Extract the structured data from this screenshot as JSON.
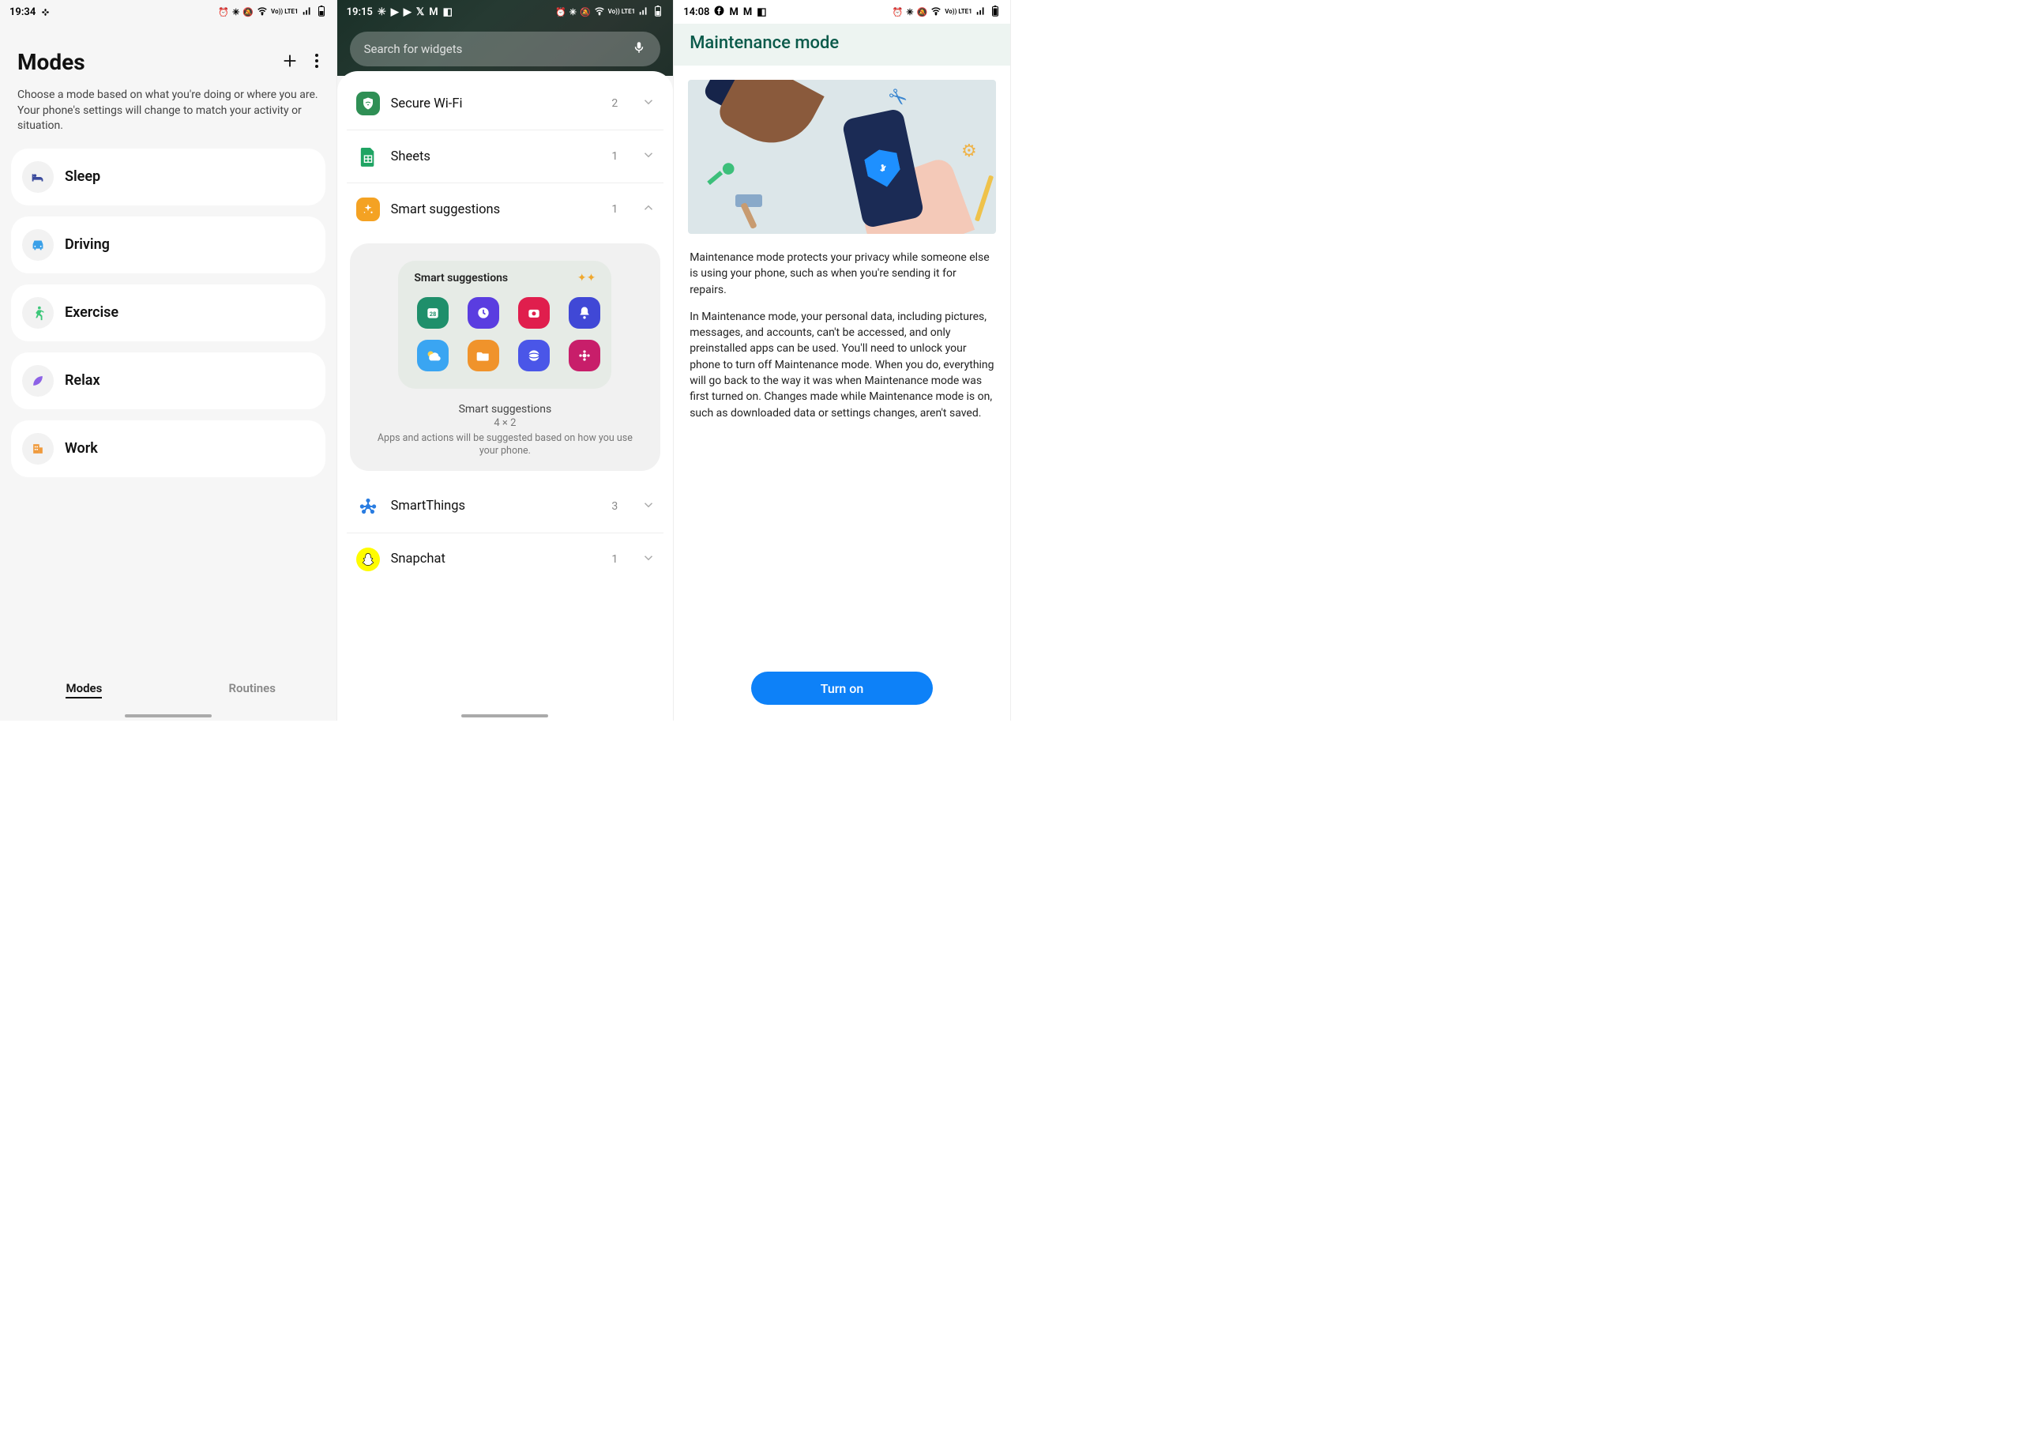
{
  "screen1": {
    "status": {
      "time": "19:34",
      "network_label": "Vo)) LTE1"
    },
    "title": "Modes",
    "description": "Choose a mode based on what you're doing or where you are. Your phone's settings will change to match your activity or situation.",
    "items": [
      {
        "label": "Sleep",
        "icon": "bed",
        "color": "#3a4a9c"
      },
      {
        "label": "Driving",
        "icon": "car",
        "color": "#3aa0e8"
      },
      {
        "label": "Exercise",
        "icon": "run",
        "color": "#3cc779"
      },
      {
        "label": "Relax",
        "icon": "leaf",
        "color": "#8d62e6"
      },
      {
        "label": "Work",
        "icon": "building",
        "color": "#ef9a3c"
      }
    ],
    "tabs": {
      "active": "Modes",
      "inactive": "Routines"
    }
  },
  "screen2": {
    "status": {
      "time": "19:15",
      "network_label": "Vo)) LTE1"
    },
    "search_placeholder": "Search for widgets",
    "rows": [
      {
        "label": "Secure Wi-Fi",
        "count": "2",
        "expanded": false,
        "icon_bg": "#2f8f55",
        "icon": "shield-wifi"
      },
      {
        "label": "Sheets",
        "count": "1",
        "expanded": false,
        "icon_bg": "#1fa463",
        "icon": "sheets"
      },
      {
        "label": "Smart suggestions",
        "count": "1",
        "expanded": true,
        "icon_bg": "#f4a223",
        "icon": "sparkle"
      },
      {
        "label": "SmartThings",
        "count": "3",
        "expanded": false,
        "icon_bg": "#ffffff",
        "icon": "smartthings"
      },
      {
        "label": "Snapchat",
        "count": "1",
        "expanded": false,
        "icon_bg": "#fffc00",
        "icon": "snapchat"
      }
    ],
    "expanded_widget": {
      "title": "Smart suggestions",
      "caption_title": "Smart suggestions",
      "caption_size": "4 × 2",
      "caption_desc": "Apps and actions will be suggested based on how you use your phone.",
      "app_colors": [
        "#1f8f6b",
        "#5a3de0",
        "#e01e4d",
        "#4048d6",
        "#3aa5f2",
        "#f0932b",
        "#4a56e8",
        "#c81e6a"
      ]
    }
  },
  "screen3": {
    "status": {
      "time": "14:08",
      "network_label": "Vo)) LTE1"
    },
    "title": "Maintenance mode",
    "para1": "Maintenance mode protects your privacy while someone else is using your phone, such as when you're sending it for repairs.",
    "para2": "In Maintenance mode, your personal data, including pictures, messages, and accounts, can't be accessed, and only preinstalled apps can be used. You'll need to unlock your phone to turn off Maintenance mode. When you do, everything will go back to the way it was when Maintenance mode was first turned on. Changes made while Maintenance mode is on, such as downloaded data or settings changes, aren't saved.",
    "button": "Turn on"
  }
}
